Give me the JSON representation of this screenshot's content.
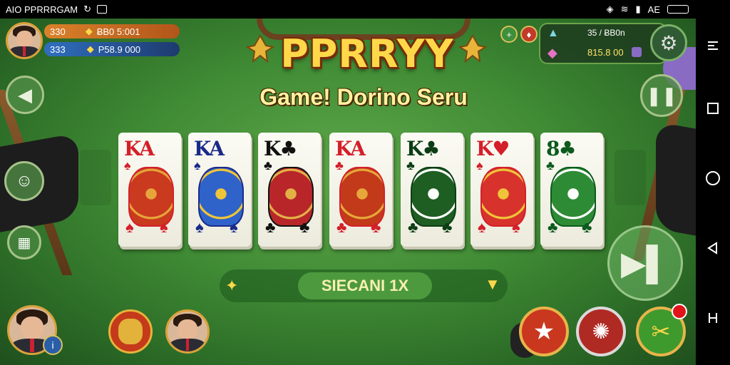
{
  "status_bar": {
    "left_text": "AIO PPRRRGAM",
    "right_text": "AE"
  },
  "header": {
    "logo_text": "PPRRYY",
    "subtitle": "Game! Dorino Seru"
  },
  "wallet": {
    "coins_a": "330",
    "coins_a_value": "ɃB0 5:001",
    "coins_b": "333",
    "coins_b_value": "P58.9 000"
  },
  "top_right": {
    "value_a": "35 / ɃB0n",
    "value_b": "815.8 00"
  },
  "cards": [
    {
      "rank": "KA",
      "color": "#d41f2a",
      "suit": "♠",
      "art_color": "#c93a1e",
      "accent": "#e7a43a"
    },
    {
      "rank": "KA",
      "color": "#1a2a8a",
      "suit": "♠",
      "art_color": "#2f63c9",
      "accent": "#f0c43a"
    },
    {
      "rank": "K♣",
      "color": "#111111",
      "suit": "♣",
      "art_color": "#b8262a",
      "accent": "#e2b146"
    },
    {
      "rank": "KA",
      "color": "#d41f2a",
      "suit": "♣",
      "art_color": "#c23a1a",
      "accent": "#e6a83a"
    },
    {
      "rank": "K♣",
      "color": "#0c3d14",
      "suit": "♣",
      "art_color": "#1e5e22",
      "accent": "#ffffff"
    },
    {
      "rank": "K♥",
      "color": "#d41f2a",
      "suit": "♠",
      "art_color": "#d7332c",
      "accent": "#f0c43a"
    },
    {
      "rank": "8♣",
      "color": "#0c5a1e",
      "suit": "♣",
      "art_color": "#2e8b35",
      "accent": "#ffffff"
    }
  ],
  "action_bar": {
    "label": "SIECANI 1X"
  },
  "colors": {
    "felt": "#3f8a34",
    "gold": "#ffd84a",
    "red_button": "#c9371f",
    "green_button": "#3f9a2e"
  }
}
